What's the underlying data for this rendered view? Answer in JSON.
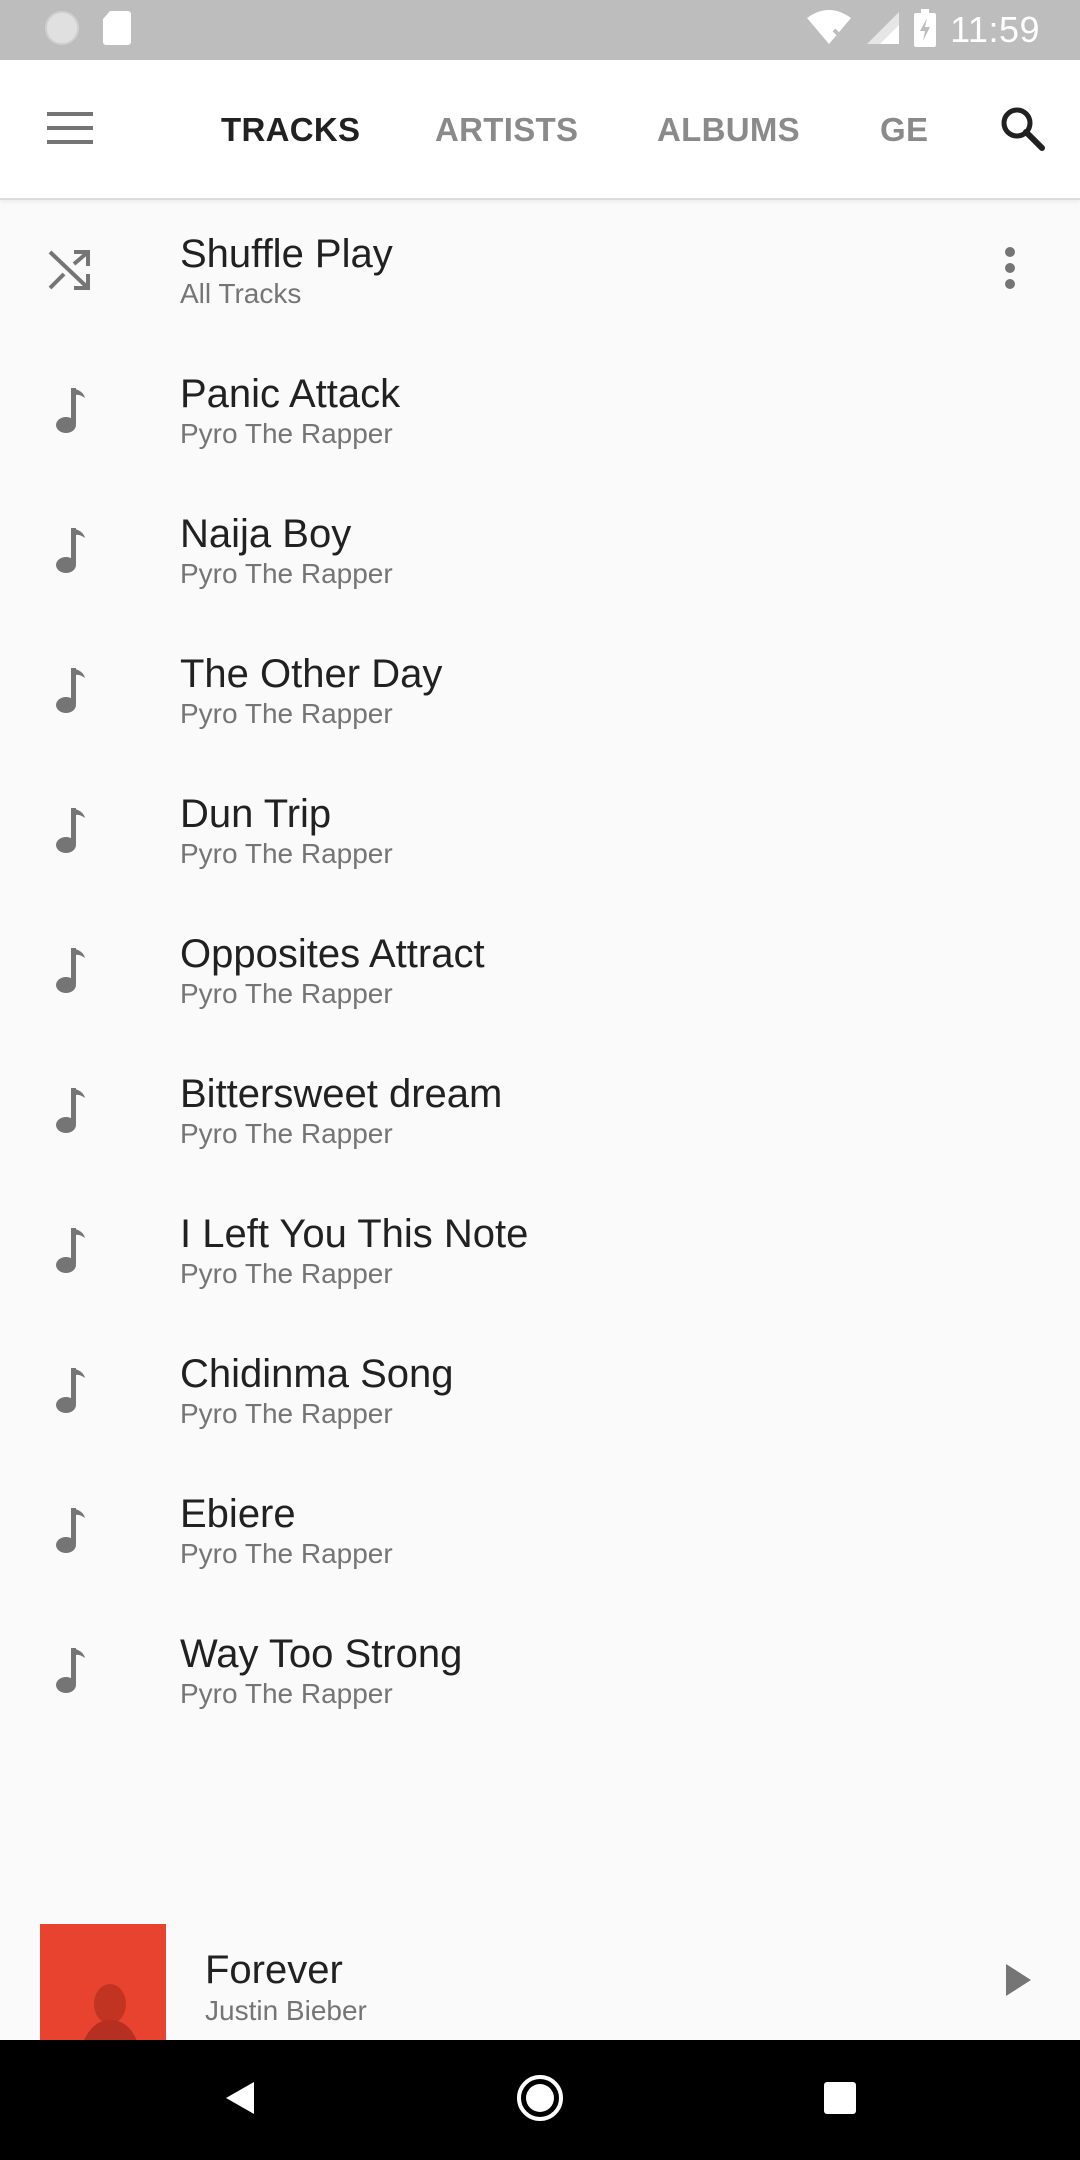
{
  "status_bar": {
    "time": "11:59",
    "icons": [
      "notification-dot-icon",
      "sd-card-icon",
      "wifi-off-icon",
      "cell-signal-icon",
      "battery-charging-icon"
    ]
  },
  "app_bar": {
    "menu_icon": "hamburger-menu-icon",
    "search_icon": "search-icon",
    "tabs": [
      {
        "label": "TRACKS",
        "active": true
      },
      {
        "label": "ARTISTS",
        "active": false
      },
      {
        "label": "ALBUMS",
        "active": false
      },
      {
        "label": "GE",
        "active": false
      }
    ]
  },
  "shuffle": {
    "title": "Shuffle Play",
    "subtitle": "All Tracks",
    "icon": "shuffle-icon",
    "more_icon": "more-vert-icon"
  },
  "tracks": [
    {
      "title": "Panic Attack",
      "artist": "Pyro The Rapper"
    },
    {
      "title": "Naija Boy",
      "artist": "Pyro The Rapper"
    },
    {
      "title": "The Other Day",
      "artist": "Pyro The Rapper"
    },
    {
      "title": "Dun Trip",
      "artist": "Pyro The Rapper"
    },
    {
      "title": "Opposites Attract",
      "artist": "Pyro The Rapper"
    },
    {
      "title": "Bittersweet dream",
      "artist": "Pyro The Rapper"
    },
    {
      "title": "I Left You This Note",
      "artist": "Pyro The Rapper"
    },
    {
      "title": "Chidinma Song",
      "artist": "Pyro The Rapper"
    },
    {
      "title": "Ebiere",
      "artist": "Pyro The Rapper"
    },
    {
      "title": "Way Too Strong",
      "artist": "Pyro The Rapper"
    }
  ],
  "now_playing": {
    "title": "Forever",
    "artist": "Justin Bieber",
    "play_icon": "play-icon"
  },
  "nav_bar": {
    "icons": [
      "back-icon",
      "home-icon",
      "recents-icon"
    ]
  },
  "colors": {
    "background": "#fafafa",
    "status_bar": "#bdbdbd",
    "active_tab": "#212121",
    "inactive_tab": "#8a8a8a",
    "icon_gray": "#757575",
    "album_art": "#e8432f"
  }
}
